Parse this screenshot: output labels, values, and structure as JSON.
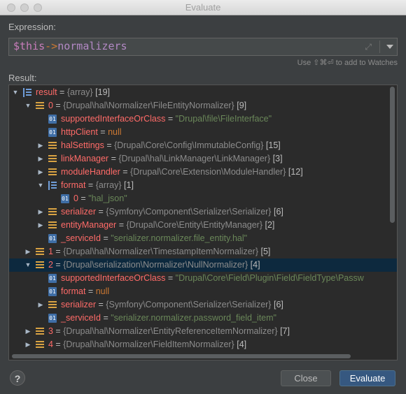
{
  "window": {
    "title": "Evaluate"
  },
  "expression": {
    "label": "Expression:",
    "var": "$this",
    "arrow": "->",
    "member": "normalizers",
    "hint": "Use ⇧⌘⏎ to add to Watches"
  },
  "result": {
    "label": "Result:",
    "rows": [
      {
        "name": "result",
        "type": "{array}",
        "count": "[19]",
        "icon": "array-icon"
      },
      {
        "name": "0",
        "type": "{Drupal\\hal\\Normalizer\\FileEntityNormalizer}",
        "count": "[9]",
        "icon": "object-icon"
      },
      {
        "name": "supportedInterfaceOrClass",
        "value": "\"Drupal\\file\\FileInterface\"",
        "icon": "primitive-icon"
      },
      {
        "name": "httpClient",
        "value": "null",
        "icon": "primitive-icon"
      },
      {
        "name": "halSettings",
        "type": "{Drupal\\Core\\Config\\ImmutableConfig}",
        "count": "[15]",
        "icon": "object-icon"
      },
      {
        "name": "linkManager",
        "type": "{Drupal\\hal\\LinkManager\\LinkManager}",
        "count": "[3]",
        "icon": "object-icon"
      },
      {
        "name": "moduleHandler",
        "type": "{Drupal\\Core\\Extension\\ModuleHandler}",
        "count": "[12]",
        "icon": "object-icon"
      },
      {
        "name": "format",
        "type": "{array}",
        "count": "[1]",
        "icon": "array-icon"
      },
      {
        "name": "0",
        "value": "\"hal_json\"",
        "icon": "primitive-icon"
      },
      {
        "name": "serializer",
        "type": "{Symfony\\Component\\Serializer\\Serializer}",
        "count": "[6]",
        "icon": "object-icon"
      },
      {
        "name": "entityManager",
        "type": "{Drupal\\Core\\Entity\\EntityManager}",
        "count": "[2]",
        "icon": "object-icon"
      },
      {
        "name": "_serviceId",
        "value": "\"serializer.normalizer.file_entity.hal\"",
        "icon": "primitive-icon"
      },
      {
        "name": "1",
        "type": "{Drupal\\hal\\Normalizer\\TimestampItemNormalizer}",
        "count": "[5]",
        "icon": "object-icon"
      },
      {
        "name": "2",
        "type": "{Drupal\\serialization\\Normalizer\\NullNormalizer}",
        "count": "[4]",
        "icon": "object-icon"
      },
      {
        "name": "supportedInterfaceOrClass",
        "value": "\"Drupal\\Core\\Field\\Plugin\\Field\\FieldType\\Passw",
        "icon": "primitive-icon"
      },
      {
        "name": "format",
        "value": "null",
        "icon": "primitive-icon"
      },
      {
        "name": "serializer",
        "type": "{Symfony\\Component\\Serializer\\Serializer}",
        "count": "[6]",
        "icon": "object-icon"
      },
      {
        "name": "_serviceId",
        "value": "\"serializer.normalizer.password_field_item\"",
        "icon": "primitive-icon"
      },
      {
        "name": "3",
        "type": "{Drupal\\hal\\Normalizer\\EntityReferenceItemNormalizer}",
        "count": "[7]",
        "icon": "object-icon"
      },
      {
        "name": "4",
        "type": "{Drupal\\hal\\Normalizer\\FieldItemNormalizer}",
        "count": "[4]",
        "icon": "object-icon"
      }
    ]
  },
  "buttons": {
    "help": "?",
    "close": "Close",
    "evaluate": "Evaluate"
  }
}
